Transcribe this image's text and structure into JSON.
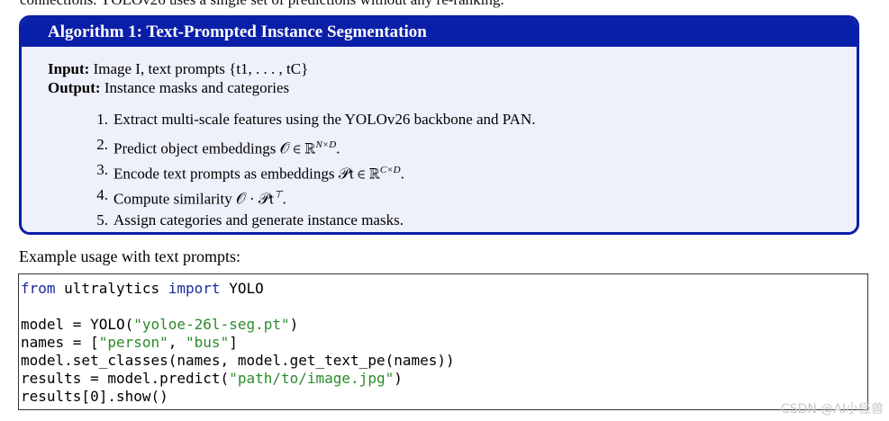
{
  "top_cut_text": "connections. YOLOv26 uses a single set of predictions without any re-ranking.",
  "algorithm": {
    "title": "Algorithm 1: Text-Prompted Instance Segmentation",
    "input_label": "Input:",
    "input_text": "Image I, text prompts {t1, . . . , tC}",
    "output_label": "Output:",
    "output_text": "Instance masks and categories",
    "steps": [
      {
        "num": "1.",
        "text": "Extract multi-scale features using the YOLOv26 backbone and PAN."
      },
      {
        "num": "2.",
        "text": "Predict object embeddings 𝒪 ∈ ℝ",
        "sup": "N×D",
        "tail": "."
      },
      {
        "num": "3.",
        "text": "Encode text prompts as embeddings 𝒫t ∈ ℝ",
        "sup": "C×D",
        "tail": "."
      },
      {
        "num": "4.",
        "text": "Compute similarity 𝒪 · 𝒫t",
        "sup": "⊤",
        "tail": "."
      },
      {
        "num": "5.",
        "text": "Assign categories and generate instance masks."
      }
    ]
  },
  "example_label": "Example usage with text prompts:",
  "code": {
    "line1_kw1": "from",
    "line1_mid": " ultralytics ",
    "line1_kw2": "import",
    "line1_end": " YOLO",
    "line3_pre": "model = YOLO(",
    "line3_str": "\"yoloe-26l-seg.pt\"",
    "line3_end": ")",
    "line4_pre": "names = [",
    "line4_str1": "\"person\"",
    "line4_mid": ", ",
    "line4_str2": "\"bus\"",
    "line4_end": "]",
    "line5": "model.set_classes(names, model.get_text_pe(names))",
    "line6_pre": "results = model.predict(",
    "line6_str": "\"path/to/image.jpg\"",
    "line6_end": ")",
    "line7": "results[0].show()"
  },
  "watermark": "CSDN @AI小怪兽"
}
